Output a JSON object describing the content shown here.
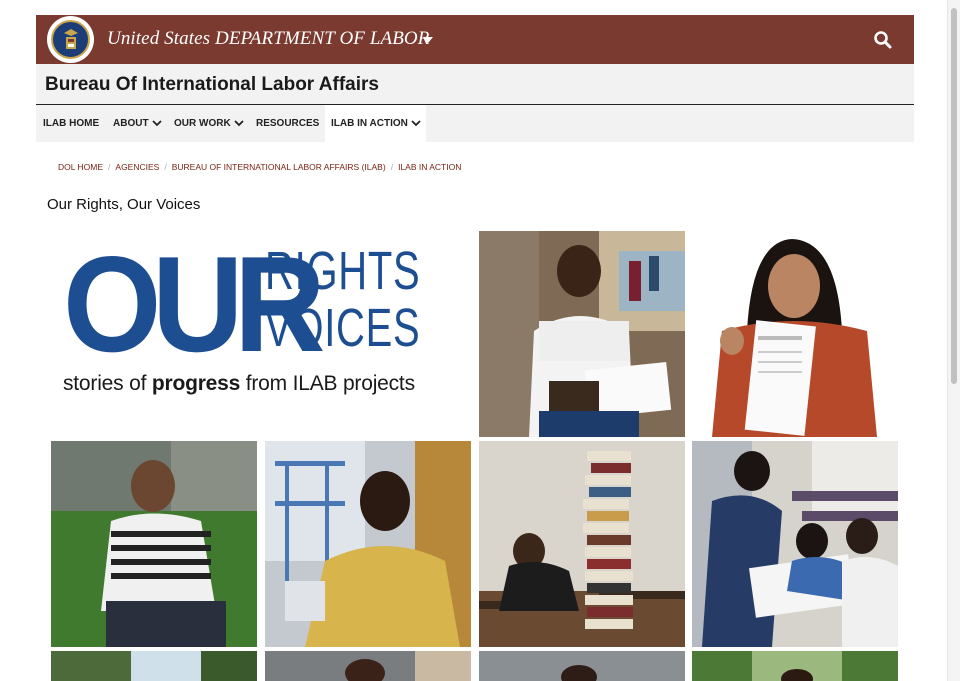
{
  "header": {
    "dol_title": "United States DEPARTMENT OF LABOR",
    "bureau_title": "Bureau Of International Labor Affairs",
    "colors": {
      "brand_bar": "#7a3a2f",
      "link": "#7a1f10"
    }
  },
  "nav": {
    "items": [
      {
        "label": "ILAB HOME",
        "has_dropdown": false
      },
      {
        "label": "ABOUT",
        "has_dropdown": true
      },
      {
        "label": "OUR WORK",
        "has_dropdown": true
      },
      {
        "label": "RESOURCES",
        "has_dropdown": false
      },
      {
        "label": "ILAB IN ACTION",
        "has_dropdown": true,
        "active": true
      }
    ]
  },
  "breadcrumb": [
    "DOL HOME",
    "AGENCIES",
    "BUREAU OF INTERNATIONAL LABOR AFFAIRS (ILAB)",
    "ILAB IN ACTION"
  ],
  "page": {
    "title": "Our Rights, Our Voices",
    "logo": {
      "our": "OUR",
      "rights": "RIGHTS",
      "voices": "VOICES",
      "tagline_pre": "stories of ",
      "tagline_bold": "progress",
      "tagline_post": " from ILAB projects"
    }
  },
  "icons": {
    "search": "search-icon",
    "seal": "dol-seal-icon",
    "dropdown": "caret-down-icon"
  }
}
